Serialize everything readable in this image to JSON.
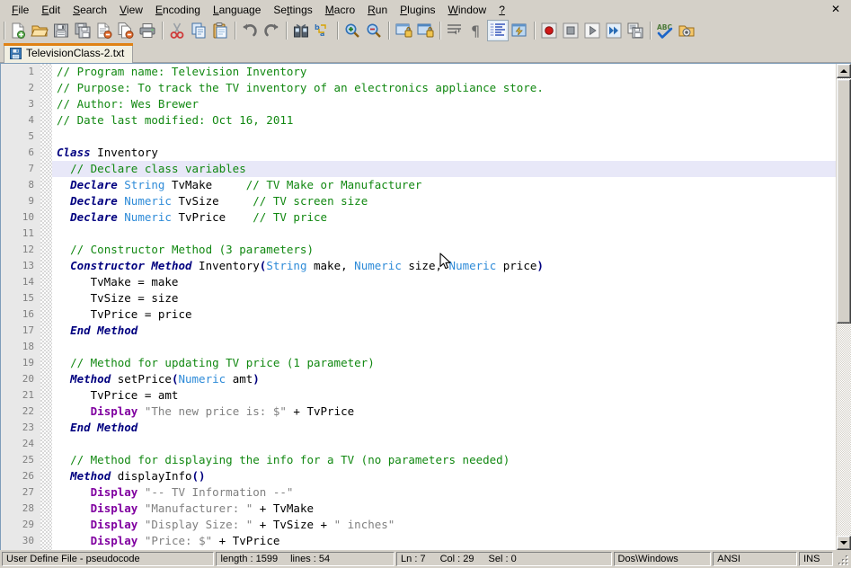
{
  "menu": {
    "items": [
      {
        "pre": "",
        "mn": "F",
        "post": "ile"
      },
      {
        "pre": "",
        "mn": "E",
        "post": "dit"
      },
      {
        "pre": "",
        "mn": "S",
        "post": "earch"
      },
      {
        "pre": "",
        "mn": "V",
        "post": "iew"
      },
      {
        "pre": "",
        "mn": "E",
        "post": "ncoding"
      },
      {
        "pre": "",
        "mn": "L",
        "post": "anguage"
      },
      {
        "pre": "Se",
        "mn": "t",
        "post": "tings"
      },
      {
        "pre": "",
        "mn": "M",
        "post": "acro"
      },
      {
        "pre": "",
        "mn": "R",
        "post": "un"
      },
      {
        "pre": "",
        "mn": "P",
        "post": "lugins"
      },
      {
        "pre": "",
        "mn": "W",
        "post": "indow"
      },
      {
        "pre": "",
        "mn": "?",
        "post": ""
      }
    ],
    "close_label": "✕"
  },
  "toolbar": {
    "buttons": [
      {
        "name": "new-file-icon",
        "title": "New"
      },
      {
        "name": "open-file-icon",
        "title": "Open"
      },
      {
        "name": "save-icon",
        "title": "Save"
      },
      {
        "name": "save-all-icon",
        "title": "Save All"
      },
      {
        "name": "close-file-icon",
        "title": "Close"
      },
      {
        "name": "close-all-files-icon",
        "title": "Close All"
      },
      {
        "name": "print-icon",
        "title": "Print"
      },
      {
        "name": "sep",
        "title": ""
      },
      {
        "name": "cut-icon",
        "title": "Cut"
      },
      {
        "name": "copy-icon",
        "title": "Copy"
      },
      {
        "name": "paste-icon",
        "title": "Paste"
      },
      {
        "name": "sep",
        "title": ""
      },
      {
        "name": "undo-icon",
        "title": "Undo"
      },
      {
        "name": "redo-icon",
        "title": "Redo"
      },
      {
        "name": "sep",
        "title": ""
      },
      {
        "name": "find-icon",
        "title": "Find"
      },
      {
        "name": "replace-icon",
        "title": "Replace"
      },
      {
        "name": "sep",
        "title": ""
      },
      {
        "name": "zoom-in-icon",
        "title": "Zoom In"
      },
      {
        "name": "zoom-out-icon",
        "title": "Zoom Out"
      },
      {
        "name": "sep",
        "title": ""
      },
      {
        "name": "sync-vertical-scroll-icon",
        "title": "Synchronize Vertical Scrolling"
      },
      {
        "name": "sync-horizontal-scroll-icon",
        "title": "Synchronize Horizontal Scrolling"
      },
      {
        "name": "sep",
        "title": ""
      },
      {
        "name": "word-wrap-icon",
        "title": "Word wrap"
      },
      {
        "name": "show-all-characters-icon",
        "title": "Show All Characters"
      },
      {
        "name": "show-indent-guide-icon",
        "title": "Show Indent Guide"
      },
      {
        "name": "user-defined-dialog-icon",
        "title": "Show UDL dialog"
      },
      {
        "name": "sep",
        "title": ""
      },
      {
        "name": "record-macro-icon",
        "title": "Start Recording"
      },
      {
        "name": "stop-macro-icon",
        "title": "Stop Recording"
      },
      {
        "name": "play-macro-icon",
        "title": "Playback"
      },
      {
        "name": "run-macro-multiple-icon",
        "title": "Run a Macro Multiple Times"
      },
      {
        "name": "save-macro-icon",
        "title": "Save Current Recorded Macro"
      },
      {
        "name": "sep",
        "title": ""
      },
      {
        "name": "spellcheck-icon",
        "title": "Spell Check"
      },
      {
        "name": "run-icon",
        "title": "Run"
      }
    ]
  },
  "tabs": [
    {
      "label": "TelevisionClass-2.txt",
      "icon": "saved-file-icon",
      "active": true
    }
  ],
  "editor": {
    "first_line": 1,
    "current_line": 7,
    "lines": [
      {
        "n": 1,
        "tokens": [
          {
            "t": "comment",
            "s": "// Program name: Television Inventory"
          }
        ]
      },
      {
        "n": 2,
        "tokens": [
          {
            "t": "comment",
            "s": "// Purpose: To track the TV inventory of an electronics appliance store."
          }
        ]
      },
      {
        "n": 3,
        "tokens": [
          {
            "t": "comment",
            "s": "// Author: Wes Brewer"
          }
        ]
      },
      {
        "n": 4,
        "tokens": [
          {
            "t": "comment",
            "s": "// Date last modified: Oct 16, 2011"
          }
        ]
      },
      {
        "n": 5,
        "tokens": []
      },
      {
        "n": 6,
        "tokens": [
          {
            "t": "kw",
            "s": "Class"
          },
          {
            "t": "plain",
            "s": " Inventory"
          }
        ]
      },
      {
        "n": 7,
        "tokens": [
          {
            "t": "plain",
            "s": "  "
          },
          {
            "t": "comment",
            "s": "// Declare class variables"
          }
        ]
      },
      {
        "n": 8,
        "tokens": [
          {
            "t": "plain",
            "s": "  "
          },
          {
            "t": "kw",
            "s": "Declare"
          },
          {
            "t": "plain",
            "s": " "
          },
          {
            "t": "type",
            "s": "String"
          },
          {
            "t": "plain",
            "s": " TvMake     "
          },
          {
            "t": "comment",
            "s": "// TV Make or Manufacturer"
          }
        ]
      },
      {
        "n": 9,
        "tokens": [
          {
            "t": "plain",
            "s": "  "
          },
          {
            "t": "kw",
            "s": "Declare"
          },
          {
            "t": "plain",
            "s": " "
          },
          {
            "t": "type",
            "s": "Numeric"
          },
          {
            "t": "plain",
            "s": " TvSize     "
          },
          {
            "t": "comment",
            "s": "// TV screen size"
          }
        ]
      },
      {
        "n": 10,
        "tokens": [
          {
            "t": "plain",
            "s": "  "
          },
          {
            "t": "kw",
            "s": "Declare"
          },
          {
            "t": "plain",
            "s": " "
          },
          {
            "t": "type",
            "s": "Numeric"
          },
          {
            "t": "plain",
            "s": " TvPrice    "
          },
          {
            "t": "comment",
            "s": "// TV price"
          }
        ]
      },
      {
        "n": 11,
        "tokens": []
      },
      {
        "n": 12,
        "tokens": [
          {
            "t": "plain",
            "s": "  "
          },
          {
            "t": "comment",
            "s": "// Constructor Method (3 parameters)"
          }
        ]
      },
      {
        "n": 13,
        "tokens": [
          {
            "t": "plain",
            "s": "  "
          },
          {
            "t": "kw",
            "s": "Constructor Method"
          },
          {
            "t": "plain",
            "s": " Inventory"
          },
          {
            "t": "punc",
            "s": "("
          },
          {
            "t": "type",
            "s": "String"
          },
          {
            "t": "plain",
            "s": " make, "
          },
          {
            "t": "type",
            "s": "Numeric"
          },
          {
            "t": "plain",
            "s": " size, "
          },
          {
            "t": "type",
            "s": "Numeric"
          },
          {
            "t": "plain",
            "s": " price"
          },
          {
            "t": "punc",
            "s": ")"
          }
        ]
      },
      {
        "n": 14,
        "tokens": [
          {
            "t": "plain",
            "s": "     TvMake = make"
          }
        ]
      },
      {
        "n": 15,
        "tokens": [
          {
            "t": "plain",
            "s": "     TvSize = size"
          }
        ]
      },
      {
        "n": 16,
        "tokens": [
          {
            "t": "plain",
            "s": "     TvPrice = price"
          }
        ]
      },
      {
        "n": 17,
        "tokens": [
          {
            "t": "plain",
            "s": "  "
          },
          {
            "t": "kw",
            "s": "End Method"
          }
        ]
      },
      {
        "n": 18,
        "tokens": []
      },
      {
        "n": 19,
        "tokens": [
          {
            "t": "plain",
            "s": "  "
          },
          {
            "t": "comment",
            "s": "// Method for updating TV price (1 parameter)"
          }
        ]
      },
      {
        "n": 20,
        "tokens": [
          {
            "t": "plain",
            "s": "  "
          },
          {
            "t": "kw",
            "s": "Method"
          },
          {
            "t": "plain",
            "s": " setPrice"
          },
          {
            "t": "punc",
            "s": "("
          },
          {
            "t": "type",
            "s": "Numeric"
          },
          {
            "t": "plain",
            "s": " amt"
          },
          {
            "t": "punc",
            "s": ")"
          }
        ]
      },
      {
        "n": 21,
        "tokens": [
          {
            "t": "plain",
            "s": "     TvPrice = amt"
          }
        ]
      },
      {
        "n": 22,
        "tokens": [
          {
            "t": "plain",
            "s": "     "
          },
          {
            "t": "disp",
            "s": "Display"
          },
          {
            "t": "plain",
            "s": " "
          },
          {
            "t": "str",
            "s": "\"The new price is: $\""
          },
          {
            "t": "plain",
            "s": " + TvPrice"
          }
        ]
      },
      {
        "n": 23,
        "tokens": [
          {
            "t": "plain",
            "s": "  "
          },
          {
            "t": "kw",
            "s": "End Method"
          }
        ]
      },
      {
        "n": 24,
        "tokens": []
      },
      {
        "n": 25,
        "tokens": [
          {
            "t": "plain",
            "s": "  "
          },
          {
            "t": "comment",
            "s": "// Method for displaying the info for a TV (no parameters needed)"
          }
        ]
      },
      {
        "n": 26,
        "tokens": [
          {
            "t": "plain",
            "s": "  "
          },
          {
            "t": "kw",
            "s": "Method"
          },
          {
            "t": "plain",
            "s": " displayInfo"
          },
          {
            "t": "punc",
            "s": "()"
          }
        ]
      },
      {
        "n": 27,
        "tokens": [
          {
            "t": "plain",
            "s": "     "
          },
          {
            "t": "disp",
            "s": "Display"
          },
          {
            "t": "plain",
            "s": " "
          },
          {
            "t": "str",
            "s": "\"-- TV Information --\""
          }
        ]
      },
      {
        "n": 28,
        "tokens": [
          {
            "t": "plain",
            "s": "     "
          },
          {
            "t": "disp",
            "s": "Display"
          },
          {
            "t": "plain",
            "s": " "
          },
          {
            "t": "str",
            "s": "\"Manufacturer: \""
          },
          {
            "t": "plain",
            "s": " + TvMake"
          }
        ]
      },
      {
        "n": 29,
        "tokens": [
          {
            "t": "plain",
            "s": "     "
          },
          {
            "t": "disp",
            "s": "Display"
          },
          {
            "t": "plain",
            "s": " "
          },
          {
            "t": "str",
            "s": "\"Display Size: \""
          },
          {
            "t": "plain",
            "s": " + TvSize + "
          },
          {
            "t": "str",
            "s": "\" inches\""
          }
        ]
      },
      {
        "n": 30,
        "tokens": [
          {
            "t": "plain",
            "s": "     "
          },
          {
            "t": "disp",
            "s": "Display"
          },
          {
            "t": "plain",
            "s": " "
          },
          {
            "t": "str",
            "s": "\"Price: $\""
          },
          {
            "t": "plain",
            "s": " + TvPrice"
          }
        ]
      }
    ]
  },
  "statusbar": {
    "language": "User Define File - pseudocode",
    "length_label": "length : 1599",
    "lines_label": "lines : 54",
    "ln": "Ln : 7",
    "col": "Col : 29",
    "sel": "Sel : 0",
    "eol": "Dos\\Windows",
    "encoding": "ANSI",
    "insert_mode": "INS"
  },
  "colors": {
    "chrome": "#d4d0c8",
    "accent_tab": "#e08214",
    "comment": "#118811",
    "keyword": "#00007f",
    "type": "#2e8bd8",
    "display": "#8000a0",
    "string": "#808080",
    "current_line": "#e8e8f8"
  }
}
